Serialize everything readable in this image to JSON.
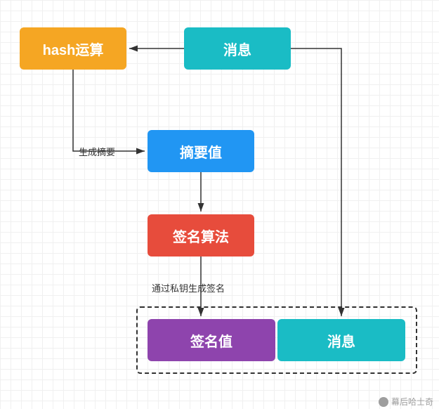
{
  "nodes": {
    "hash": {
      "label": "hash运算"
    },
    "msg_top": {
      "label": "消息"
    },
    "digest": {
      "label": "摘要值"
    },
    "sign_alg": {
      "label": "签名算法"
    },
    "sign_val": {
      "label": "签名值"
    },
    "msg_bot": {
      "label": "消息"
    }
  },
  "edges": {
    "gen_digest": {
      "label": "生成摘要"
    },
    "private_key": {
      "label": "通过私钥生成签名"
    }
  },
  "watermark": {
    "text": "幕后哈士奇"
  }
}
